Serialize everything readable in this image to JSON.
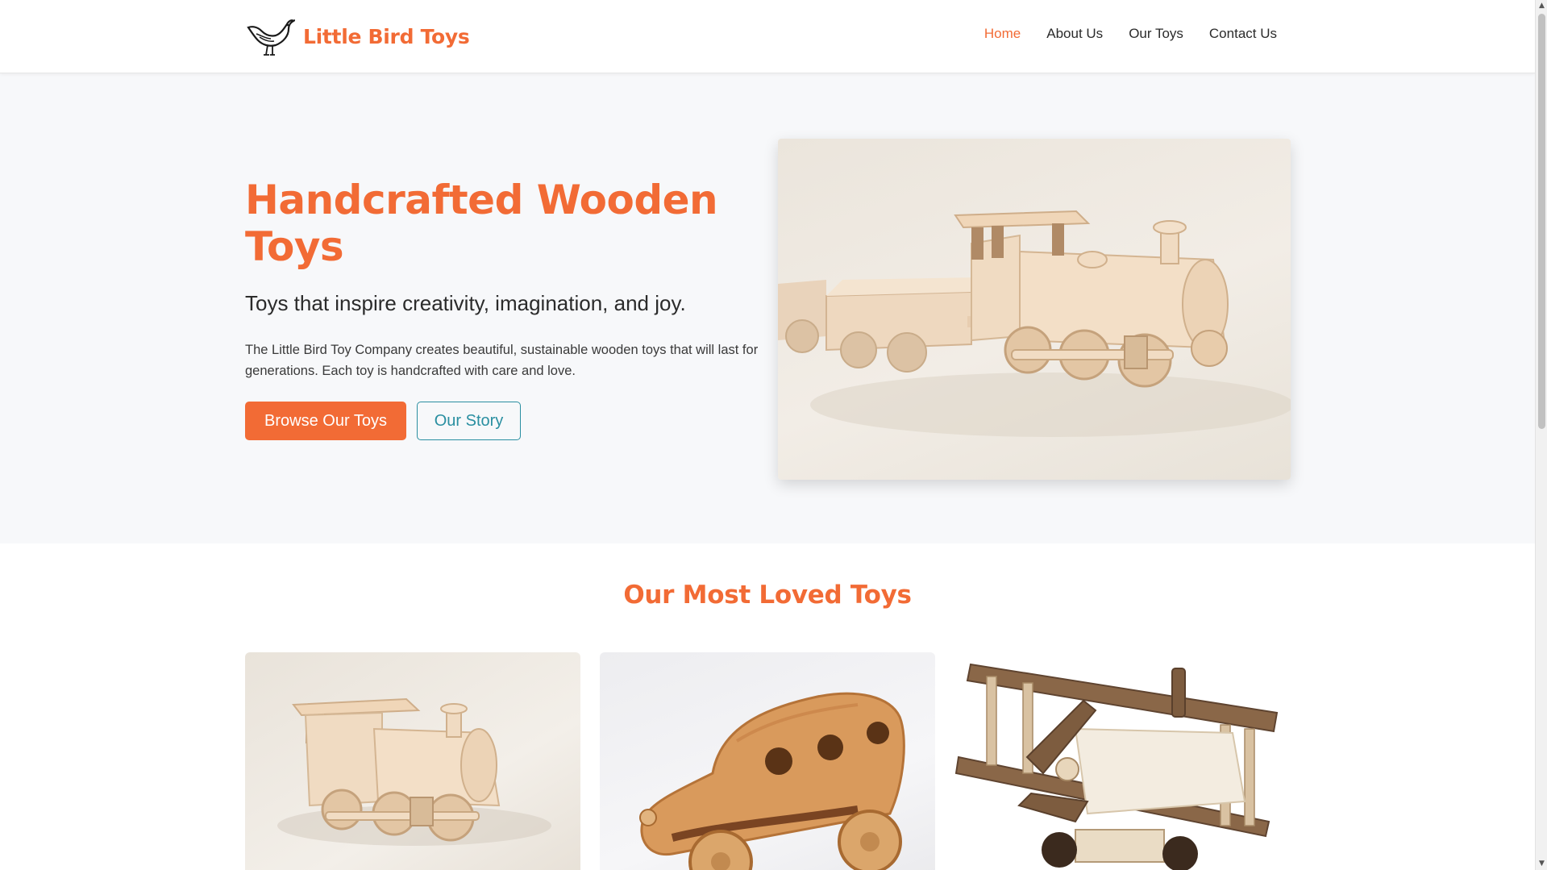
{
  "brand": {
    "name": "Little Bird Toys",
    "logo_icon": "bird-icon"
  },
  "nav": {
    "items": [
      {
        "label": "Home",
        "active": true
      },
      {
        "label": "About Us",
        "active": false
      },
      {
        "label": "Our Toys",
        "active": false
      },
      {
        "label": "Contact Us",
        "active": false
      }
    ]
  },
  "hero": {
    "title": "Handcrafted Wooden Toys",
    "subtitle": "Toys that inspire creativity, imagination, and joy.",
    "text": "The Little Bird Toy Company creates beautiful, sustainable wooden toys that will last for generations. Each toy is handcrafted with care and love.",
    "primary_button": "Browse Our Toys",
    "secondary_button": "Our Story",
    "image_subject": "wooden toy train"
  },
  "featured": {
    "title": "Our Most Loved Toys",
    "cards": [
      {
        "image_subject": "wooden toy locomotive"
      },
      {
        "image_subject": "wooden toy car"
      },
      {
        "image_subject": "wooden toy biplane"
      }
    ]
  },
  "colors": {
    "accent": "#f26b35",
    "secondary": "#2a8fa1",
    "hero_bg": "#f7f8fa",
    "text": "#2b2b2b"
  }
}
